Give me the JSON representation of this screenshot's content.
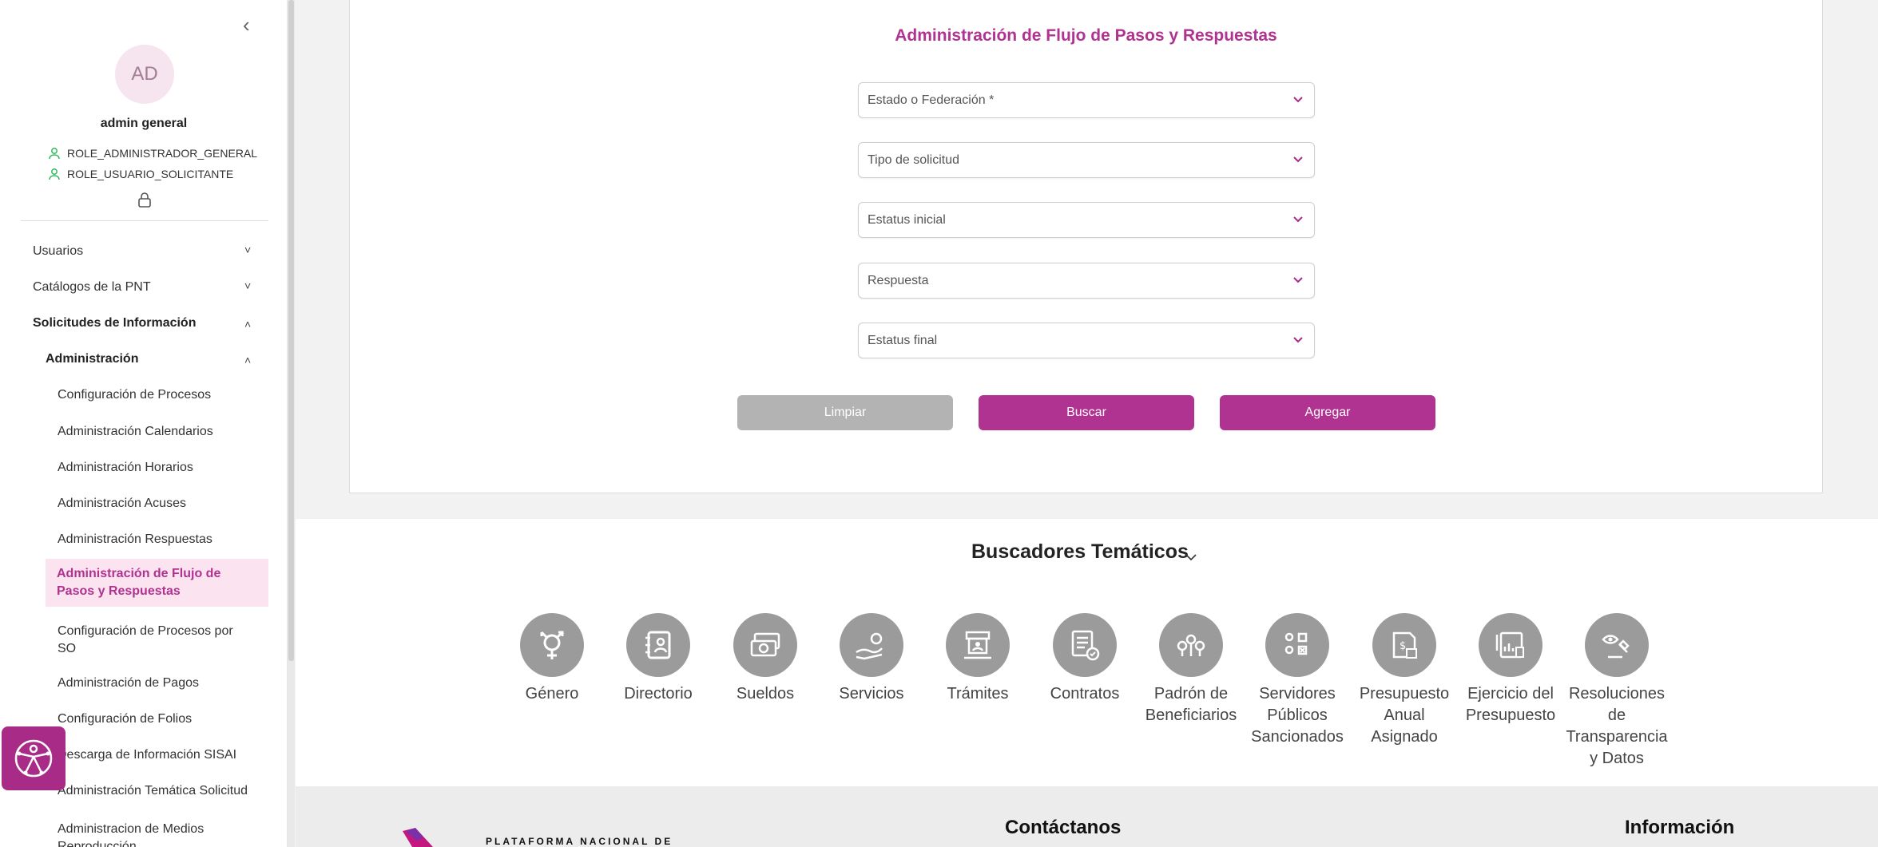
{
  "sidebar": {
    "avatar_initials": "AD",
    "user_name": "admin general",
    "roles": [
      "ROLE_ADMINISTRADOR_GENERAL",
      "ROLE_USUARIO_SOLICITANTE"
    ],
    "menu": {
      "usuarios": "Usuarios",
      "catalogos": "Catálogos de la PNT",
      "solicitudes": "Solicitudes de Información",
      "administracion": "Administración",
      "items": [
        "Configuración de Procesos",
        "Administración Calendarios",
        "Administración Horarios",
        "Administración Acuses",
        "Administración Respuestas",
        "Administración de Flujo de Pasos y Respuestas",
        "Configuración de Procesos por SO",
        "Administración de Pagos",
        "Configuración de Folios",
        "Descarga de Información SISAI",
        "Administración Temática Solicitud",
        "Administracion de Medios Reproducción"
      ]
    }
  },
  "form": {
    "title": "Administración de Flujo de Pasos y Respuestas",
    "fields": [
      "Estado o Federación *",
      "Tipo de solicitud",
      "Estatus inicial",
      "Respuesta",
      "Estatus final"
    ],
    "buttons": {
      "clear": "Limpiar",
      "search": "Buscar",
      "add": "Agregar"
    }
  },
  "thematic": {
    "title": "Buscadores Temáticos",
    "items": [
      "Género",
      "Directorio",
      "Sueldos",
      "Servicios",
      "Trámites",
      "Contratos",
      "Padrón de Beneficiarios",
      "Servidores Públicos Sancionados",
      "Presupuesto Anual Asignado",
      "Ejercicio del Presupuesto",
      "Resoluciones de Transparencia y Datos"
    ],
    "icons": [
      "gender-icon",
      "directory-icon",
      "salary-icon",
      "services-icon",
      "procedures-icon",
      "contracts-icon",
      "beneficiaries-icon",
      "sanctioned-officials-icon",
      "budget-icon",
      "budget-exercise-icon",
      "resolutions-icon"
    ]
  },
  "footer": {
    "contact": "Contáctanos",
    "info": "Información",
    "logo_text": "PLATAFORMA NACIONAL DE"
  },
  "colors": {
    "accent": "#b03291",
    "icon_bg": "#9b9b9b",
    "disabled": "#b3b3b3",
    "role_icon": "#2fb85c"
  }
}
